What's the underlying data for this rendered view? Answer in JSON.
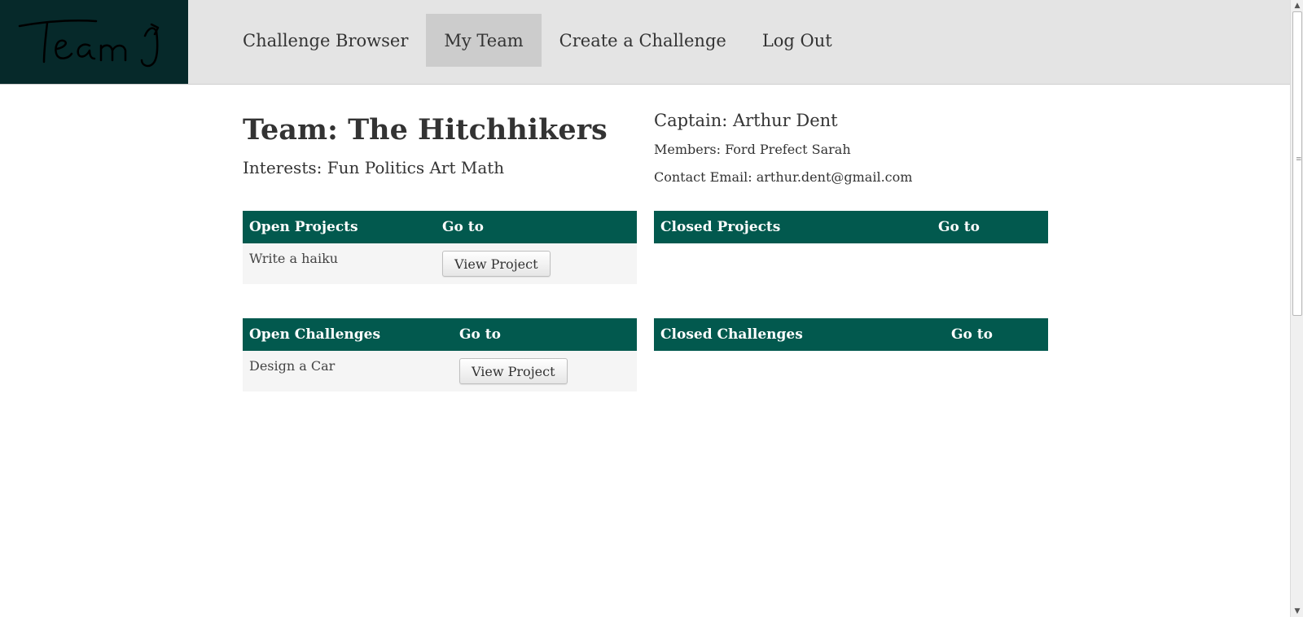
{
  "logo": {
    "text": "Team",
    "icon": "team-logo-handwritten"
  },
  "nav": {
    "items": [
      {
        "label": "Challenge Browser",
        "active": false
      },
      {
        "label": "My Team",
        "active": true
      },
      {
        "label": "Create a Challenge",
        "active": false
      },
      {
        "label": "Log Out",
        "active": false
      }
    ]
  },
  "team": {
    "title": "Team: The Hitchhikers",
    "interests": "Interests: Fun Politics Art Math",
    "captain": "Captain: Arthur Dent",
    "members": "Members: Ford Prefect Sarah",
    "contact": "Contact Email: arthur.dent@gmail.com"
  },
  "open_projects": {
    "headers": [
      "Open Projects",
      "Go to"
    ],
    "rows": [
      {
        "name": "Write a haiku",
        "button": "View Project"
      }
    ]
  },
  "closed_projects": {
    "headers": [
      "Closed Projects",
      "Go to"
    ],
    "rows": []
  },
  "open_challenges": {
    "headers": [
      "Open Challenges",
      "Go to"
    ],
    "rows": [
      {
        "name": "Design a Car",
        "button": "View Project"
      }
    ]
  },
  "closed_challenges": {
    "headers": [
      "Closed Challenges",
      "Go to"
    ],
    "rows": []
  },
  "colors": {
    "logo_bg": "#06292a",
    "nav_bg": "#e4e4e4",
    "nav_active_bg": "#cccccc",
    "table_header_bg": "#02594e",
    "table_row_bg": "#f5f5f5"
  }
}
